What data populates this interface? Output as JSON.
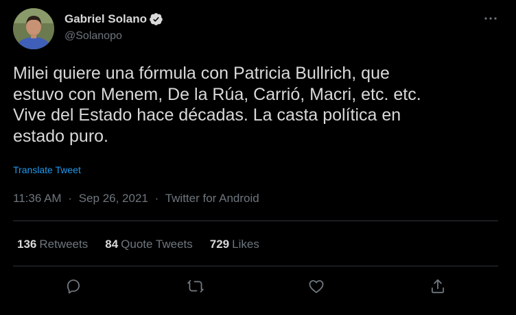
{
  "author": {
    "name": "Gabriel Solano",
    "handle": "@Solanopo"
  },
  "tweet": {
    "text": "Milei quiere una fórmula con Patricia Bullrich, que\nestuvo con Menem, De la Rúa, Carrió, Macri, etc. etc.\nVive del Estado hace décadas. La casta política en\nestado puro.",
    "translate_label": "Translate Tweet",
    "time": "11:36 AM",
    "date": "Sep 26, 2021",
    "source": "Twitter for Android",
    "separator": "·"
  },
  "stats": {
    "retweets_count": "136",
    "retweets_label": "Retweets",
    "quotes_count": "84",
    "quotes_label": "Quote Tweets",
    "likes_count": "729",
    "likes_label": "Likes"
  },
  "colors": {
    "background": "#000000",
    "text": "#d9d9d9",
    "secondary": "#6e767d",
    "link": "#1d9bf0",
    "divider": "#2f3336"
  },
  "icons": {
    "avatar": "avatar",
    "verified": "verified-badge-icon",
    "more": "more-horizontal-icon",
    "reply": "reply-icon",
    "retweet": "retweet-icon",
    "like": "heart-icon",
    "share": "share-icon"
  }
}
